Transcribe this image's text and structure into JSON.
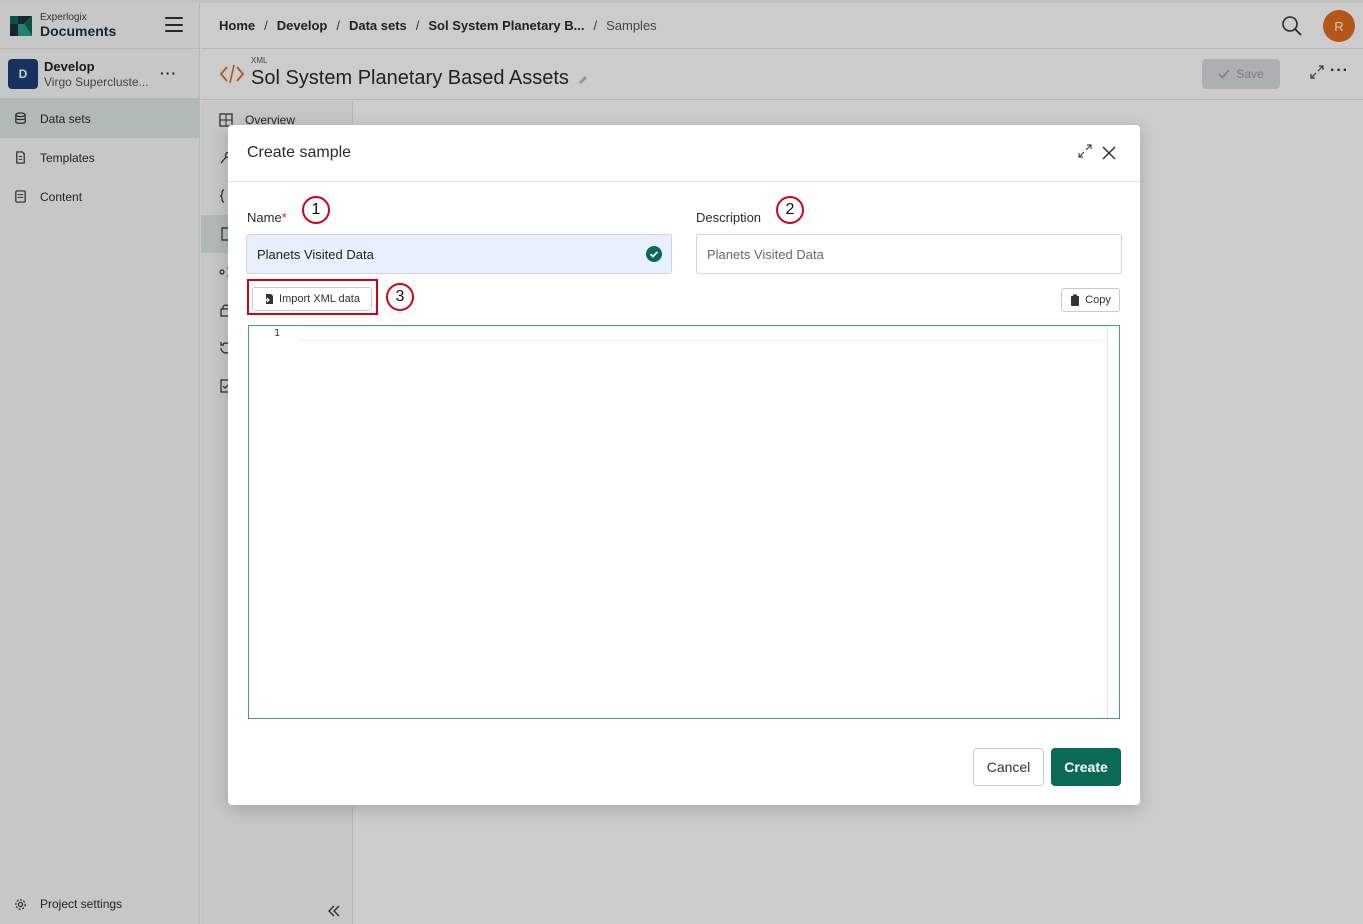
{
  "brand": {
    "small": "Experlogix",
    "big": "Documents"
  },
  "project": {
    "badge": "D",
    "name": "Develop",
    "subtitle": "Virgo Supercluste..."
  },
  "sidebar": {
    "items": [
      {
        "label": "Data sets",
        "icon": "database-icon",
        "active": true
      },
      {
        "label": "Templates",
        "icon": "document-icon",
        "active": false
      },
      {
        "label": "Content",
        "icon": "content-icon",
        "active": false
      }
    ],
    "footer": "Project settings"
  },
  "breadcrumb": {
    "items": [
      "Home",
      "Develop",
      "Data sets",
      "Sol System Planetary B..."
    ],
    "current": "Samples"
  },
  "user": {
    "initial": "R"
  },
  "page": {
    "type_tag": "XML",
    "title": "Sol System Planetary Based Assets",
    "save_label": "Save"
  },
  "subnav": {
    "first_label": "Overview"
  },
  "modal": {
    "title": "Create sample",
    "name_label": "Name",
    "required_mark": "*",
    "name_value": "Planets Visited Data",
    "description_label": "Description",
    "description_placeholder": "Planets Visited Data",
    "import_label": "Import XML data",
    "copy_label": "Copy",
    "line_number": "1",
    "cancel_label": "Cancel",
    "create_label": "Create"
  },
  "annotations": [
    "1",
    "2",
    "3"
  ],
  "colors": {
    "accent": "#0b6a56",
    "brand_orange": "#e36b1f",
    "annotation_red": "#d0021b",
    "project_badge": "#1d3f73"
  }
}
